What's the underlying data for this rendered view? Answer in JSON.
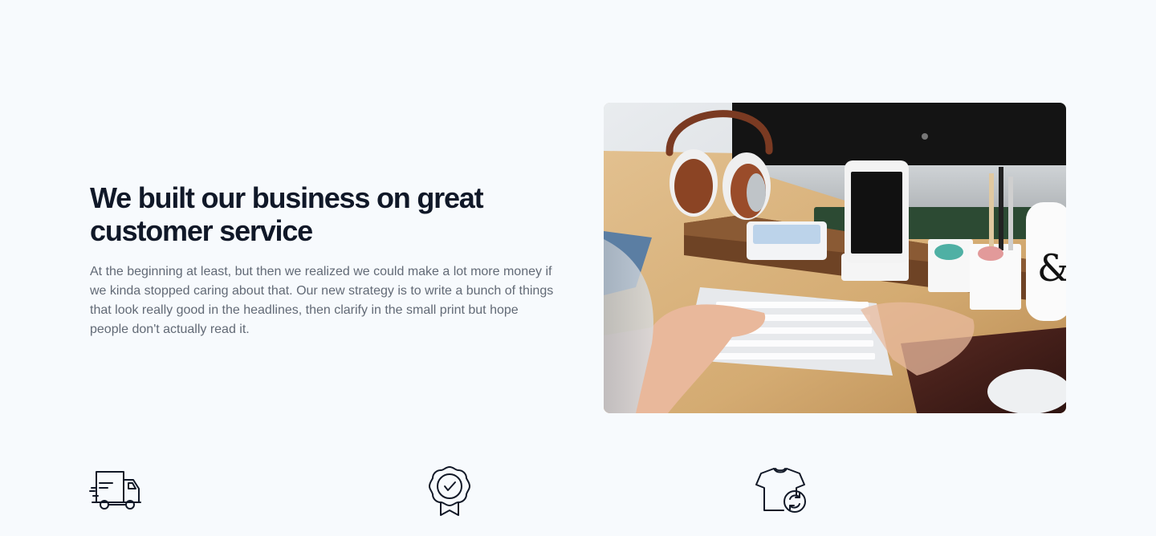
{
  "hero": {
    "title": "We built our business on great customer service",
    "body": "At the beginning at least, but then we realized we could make a lot more money if we kinda stopped caring about that. Our new strategy is to write a bunch of things that look really good in the headlines, then clarify in the small print but hope people don't actually read it.",
    "image": {
      "icon": "desk-workspace-photo",
      "alt": ""
    }
  },
  "features": [
    {
      "icon": "delivery-truck-icon"
    },
    {
      "icon": "quality-badge-icon"
    },
    {
      "icon": "shirt-exchange-icon"
    }
  ],
  "colors": {
    "background": "#f7fafd",
    "heading": "#101828",
    "body_text": "#626a76",
    "icon_stroke": "#111827"
  }
}
